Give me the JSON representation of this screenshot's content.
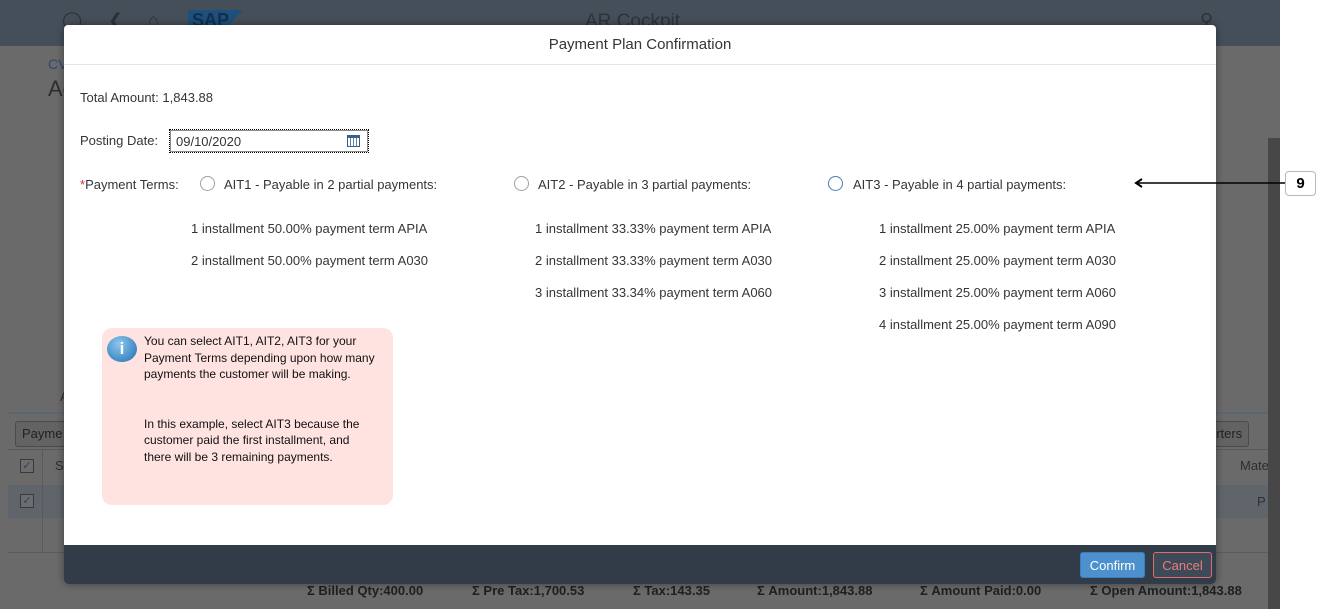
{
  "background": {
    "shell_title": "AR Cockpit",
    "logo": "SAP",
    "breadcrumb": "CV",
    "page_title_fragment": "Ac",
    "tab_fragment": "A",
    "payment_button_fragment": "Payme",
    "sorters_button_fragment": "orters",
    "column_s": "S",
    "column_material_fragment": "Mate",
    "row_cell_fragment": "P",
    "sums": {
      "billed_qty": "Σ Billed Qty:400.00",
      "pre_tax": "Σ Pre Tax:1,700.53",
      "tax": "Σ Tax:143.35",
      "amount": "Σ Amount:1,843.88",
      "amount_paid": "Σ Amount Paid:0.00",
      "open_amount": "Σ Open Amount:1,843.88"
    }
  },
  "dialog": {
    "title": "Payment Plan Confirmation",
    "total_amount_label": "Total Amount:",
    "total_amount_value": "1,843.88",
    "posting_date_label": "Posting Date:",
    "posting_date_value": "09/10/2020",
    "required_mark": "*",
    "payment_terms_label": "Payment Terms:",
    "options": [
      {
        "label": "AIT1 - Payable in 2 partial payments:",
        "selected": false,
        "installments": [
          "1 installment 50.00% payment term APIA",
          "2 installment 50.00% payment term A030"
        ]
      },
      {
        "label": "AIT2 - Payable in 3 partial payments:",
        "selected": false,
        "installments": [
          "1 installment 33.33% payment term APIA",
          "2 installment 33.33% payment term A030",
          "3 installment 33.34% payment term A060"
        ]
      },
      {
        "label": "AIT3 - Payable in 4 partial payments:",
        "selected": false,
        "installments": [
          "1 installment 25.00% payment term APIA",
          "2 installment 25.00% payment term A030",
          "3 installment 25.00% payment term A060",
          "4 installment 25.00% payment term A090"
        ]
      }
    ],
    "confirm_label": "Confirm",
    "cancel_label": "Cancel"
  },
  "note": {
    "paragraph1": "You can select AIT1, AIT2, AIT3 for your Payment Terms depending upon how many payments the customer will be making.",
    "paragraph2": "In this example, select AIT3 because the customer paid the first installment, and there will be 3 remaining payments."
  },
  "callout_number": "9"
}
